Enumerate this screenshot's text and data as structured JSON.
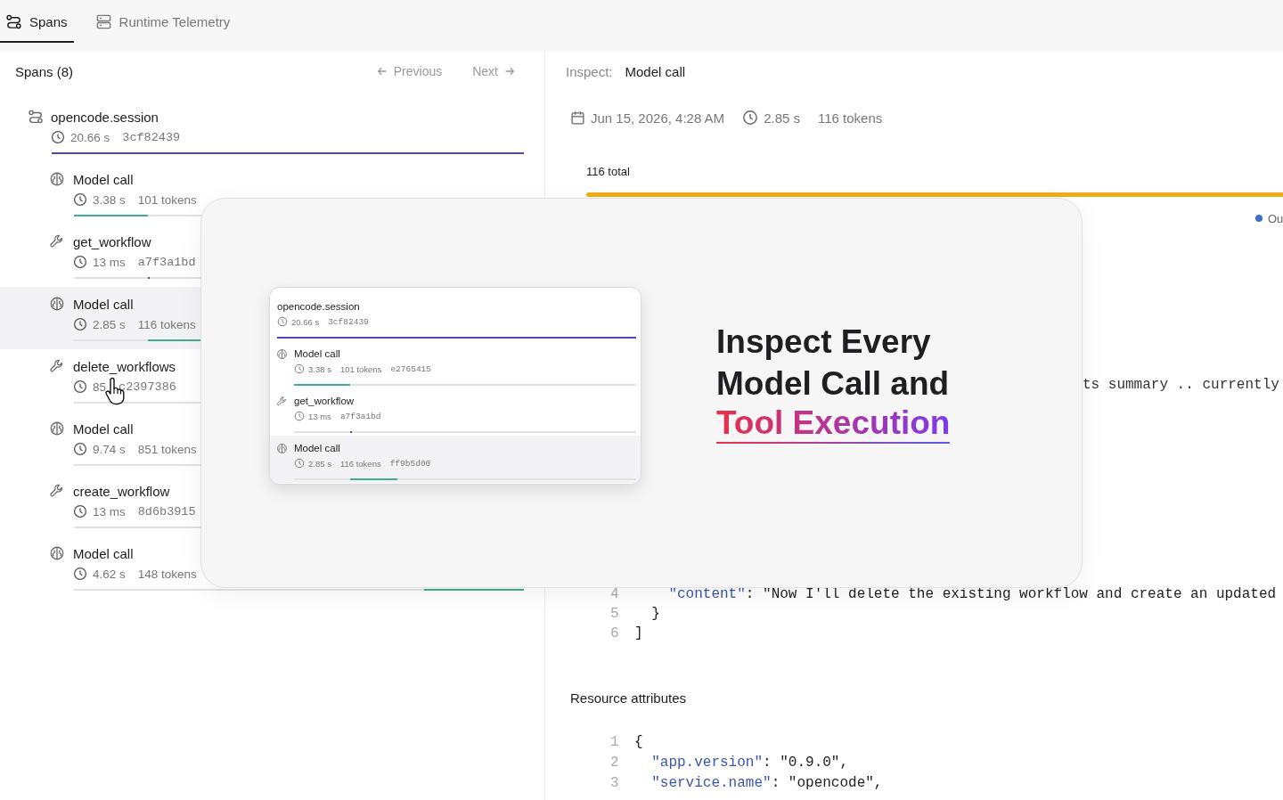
{
  "tabs": [
    {
      "kind": "spans",
      "label": "Spans",
      "selected": true
    },
    {
      "kind": "telemetry",
      "label": "Runtime Telemetry",
      "selected": false
    }
  ],
  "spans_panel": {
    "title": "Spans (8)",
    "previous": "Previous",
    "next": "Next",
    "spans": [
      {
        "kind": "session",
        "name": "opencode.session",
        "duration": "20.66 s",
        "hash": "3cf82439",
        "selected": false
      },
      {
        "kind": "model",
        "name": "Model call",
        "duration": "3.38 s",
        "tokens": "101 tokens",
        "selected": false
      },
      {
        "kind": "tool",
        "name": "get_workflow",
        "duration": "13 ms",
        "hash": "a7f3a1bd",
        "selected": false
      },
      {
        "kind": "model",
        "name": "Model call",
        "duration": "2.85 s",
        "tokens": "116 tokens",
        "selected": true
      },
      {
        "kind": "tool",
        "name": "delete_workflows",
        "duration": "85",
        "hash": "c2397386",
        "selected": false
      },
      {
        "kind": "model",
        "name": "Model call",
        "duration": "9.74 s",
        "tokens": "851 tokens",
        "selected": false
      },
      {
        "kind": "tool",
        "name": "create_workflow",
        "duration": "13 ms",
        "hash": "8d6b3915",
        "selected": false
      },
      {
        "kind": "model",
        "name": "Model call",
        "duration": "4.62 s",
        "tokens": "148 tokens",
        "selected": false
      }
    ]
  },
  "inspector": {
    "label": "Inspect:",
    "title": "Model call",
    "date": "Jun 15, 2026, 4:28 AM",
    "duration": "2.85 s",
    "tokens": "116 tokens",
    "total": "116 total",
    "legend": [
      {
        "label": "Ou",
        "color": "#3b6fd8"
      }
    ],
    "code_fragment": "ts summary .. currently",
    "messages_code": [
      {
        "number": "4",
        "parts": [
          {
            "kind": "key",
            "text": "    \"content\""
          },
          {
            "kind": "plain",
            "text": ": \"Now I'll delete the existing workflow and create an updated"
          }
        ]
      },
      {
        "number": "5",
        "parts": [
          {
            "kind": "plain",
            "text": "  }"
          }
        ]
      },
      {
        "number": "6",
        "parts": [
          {
            "kind": "plain",
            "text": "]"
          }
        ]
      }
    ],
    "resource_title": "Resource attributes",
    "resource_code": [
      {
        "number": "1",
        "parts": [
          {
            "kind": "plain",
            "text": "{"
          }
        ]
      },
      {
        "number": "2",
        "parts": [
          {
            "kind": "key",
            "text": "  \"app.version\""
          },
          {
            "kind": "plain",
            "text": ": \"0.9.0\","
          }
        ]
      },
      {
        "number": "3",
        "parts": [
          {
            "kind": "key",
            "text": "  \"service.name\""
          },
          {
            "kind": "plain",
            "text": ": \"opencode\","
          }
        ]
      }
    ]
  },
  "overlay": {
    "headline": "Inspect Every Model Call and",
    "highlight": "Tool Execution",
    "spans": [
      {
        "kind": "session",
        "name": "opencode.session",
        "duration": "20.66 s",
        "hash": "3cf82439",
        "selected": false
      },
      {
        "kind": "model",
        "name": "Model call",
        "duration": "3.38 s",
        "tokens": "101 tokens",
        "hash": "e2765415",
        "selected": false
      },
      {
        "kind": "tool",
        "name": "get_workflow",
        "duration": "13 ms",
        "hash": "a7f3a1bd",
        "selected": false
      },
      {
        "kind": "model",
        "name": "Model call",
        "duration": "2.85 s",
        "tokens": "116 tokens",
        "hash": "ff9b5d00",
        "selected": true
      }
    ]
  }
}
